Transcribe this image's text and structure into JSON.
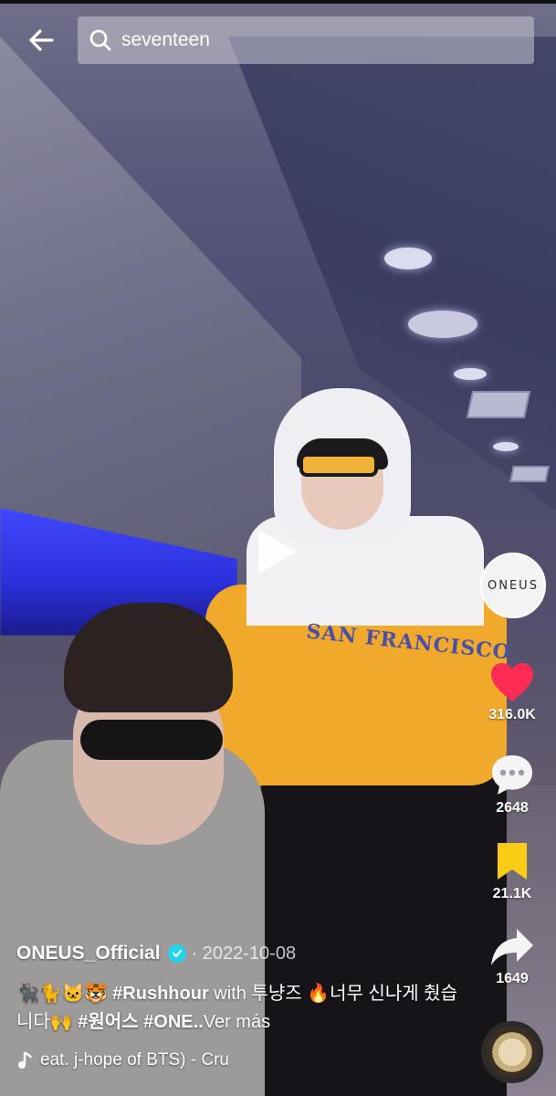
{
  "search": {
    "query": "seventeen"
  },
  "video": {
    "overlay_text": "SAN FRANCISCO"
  },
  "rail": {
    "avatar_text": "ONEUS",
    "likes": "316.0K",
    "comments": "2648",
    "saves": "21.1K",
    "shares": "1649"
  },
  "post": {
    "author": "ONEUS_Official",
    "date": "· 2022-10-08",
    "caption_emoji": "🐈‍⬛🐈🐱🐯 ",
    "caption_tag1": "#Rushhour",
    "caption_with": " with 투냥즈 🔥너무 신나게 췄습니다🙌 ",
    "caption_tag2": "#원어스 #ONE..",
    "more_label": "Ver más",
    "music": "eat. j-hope of BTS) - Cru"
  },
  "colors": {
    "like": "#fe2c55",
    "save": "#facc15",
    "verified": "#20d5ec"
  }
}
